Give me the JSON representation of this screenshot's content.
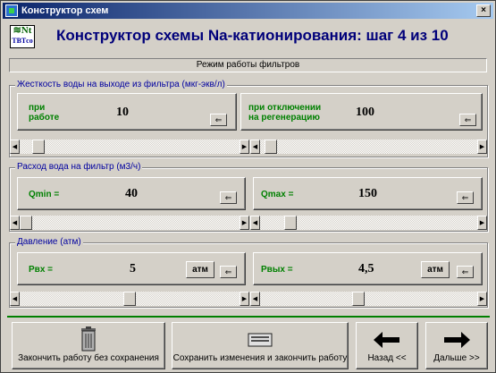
{
  "window": {
    "title": "Конструктор схем",
    "close_label": "×"
  },
  "logo": {
    "top": "≋Nt",
    "bottom": "ТВТco"
  },
  "header": {
    "title": "Конструктор схемы Na-катионирования: шаг 4 из 10"
  },
  "section": {
    "title": "Режим работы фильтров"
  },
  "groups": [
    {
      "label": "Жесткость воды на выходе из фильтра (мкг-экв/л)",
      "left": {
        "label_line1": "при",
        "label_line2": "работе",
        "value": "10",
        "button": "⇐",
        "slider_fraction": 0.06
      },
      "right": {
        "label_line1": "при отключении",
        "label_line2": "на регенерацию",
        "value": "100",
        "button": "⇐",
        "slider_fraction": 0.02
      }
    },
    {
      "label": "Расход вода на фильтр (м3/ч)",
      "left": {
        "label": "Qmin =",
        "value": "40",
        "button": "⇐",
        "slider_fraction": 0.0
      },
      "right": {
        "label": "Qmax =",
        "value": "150",
        "button": "⇐",
        "slider_fraction": 0.12
      }
    },
    {
      "label": "Давление (атм)",
      "left": {
        "label": "Рвх =",
        "value": "5",
        "unit": "атм",
        "button": "⇐",
        "slider_fraction": 0.5
      },
      "right": {
        "label": "Рвых =",
        "value": "4,5",
        "unit": "атм",
        "button": "⇐",
        "slider_fraction": 0.45
      }
    }
  ],
  "buttons": {
    "exit_no_save": "Закончить работу без сохранения",
    "save_exit": "Сохранить изменения и закончить работу",
    "back": "Назад <<",
    "next": "Дальше >>"
  },
  "icons": [
    "trash-can-icon",
    "keyboard-icon",
    "arrow-left-icon",
    "arrow-right-icon",
    "scroll-left-icon",
    "scroll-right-icon"
  ]
}
